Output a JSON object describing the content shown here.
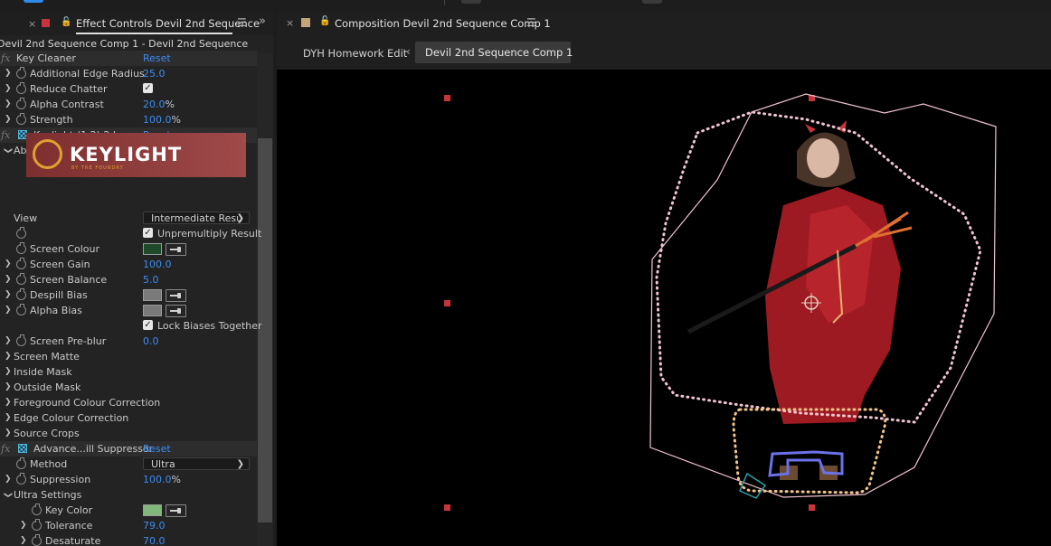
{
  "left_panel": {
    "tab": {
      "close": "×",
      "title": "Effect Controls Devil 2nd Sequence",
      "menu": "☰",
      "expand": "»"
    },
    "breadcrumb": "Devil 2nd Sequence Comp 1 - Devil 2nd Sequence",
    "rows": {
      "key_cleaner": {
        "fx": "fx",
        "label": "Key Cleaner",
        "reset": "Reset"
      },
      "edge_radius": {
        "label": "Additional Edge Radius",
        "value": "25.0"
      },
      "reduce_chatter": {
        "label": "Reduce Chatter",
        "checked": true
      },
      "alpha_contrast": {
        "label": "Alpha Contrast",
        "value": "20.0",
        "unit": "%"
      },
      "strength": {
        "label": "Strength",
        "value": "100.0",
        "unit": "%"
      },
      "keylight": {
        "fx": "fx",
        "label": "Keylight (1.2) 2 Lower",
        "reset": "Reset"
      },
      "about": {
        "label": "About"
      },
      "logo": {
        "text": "KEYLIGHT",
        "subtext": "BY THE FOUNDRY"
      },
      "view": {
        "label": "View",
        "value": "Intermediate Resu"
      },
      "unpremultiply": {
        "label": "Unpremultiply Result",
        "checked": true
      },
      "screen_colour": {
        "label": "Screen Colour",
        "color": "#1f4a2a"
      },
      "screen_gain": {
        "label": "Screen Gain",
        "value": "100.0"
      },
      "screen_balance": {
        "label": "Screen Balance",
        "value": "5.0"
      },
      "despill_bias": {
        "label": "Despill Bias",
        "color": "#7a7a7a"
      },
      "alpha_bias": {
        "label": "Alpha Bias",
        "color": "#7a7a7a"
      },
      "lock_biases": {
        "label": "Lock Biases Together",
        "checked": true
      },
      "screen_preblur": {
        "label": "Screen Pre-blur",
        "value": "0.0"
      },
      "screen_matte": {
        "label": "Screen Matte"
      },
      "inside_mask": {
        "label": "Inside Mask"
      },
      "outside_mask": {
        "label": "Outside Mask"
      },
      "fg_correction": {
        "label": "Foreground Colour Correction"
      },
      "edge_correction": {
        "label": "Edge Colour Correction"
      },
      "source_crops": {
        "label": "Source Crops"
      },
      "spill": {
        "fx": "fx",
        "label": "Advance...ill Suppressor",
        "reset": "Reset"
      },
      "method": {
        "label": "Method",
        "value": "Ultra"
      },
      "suppression": {
        "label": "Suppression",
        "value": "100.0",
        "unit": "%"
      },
      "ultra_settings": {
        "label": "Ultra Settings"
      },
      "key_color": {
        "label": "Key Color",
        "color": "#7fb87a"
      },
      "tolerance": {
        "label": "Tolerance",
        "value": "79.0"
      },
      "desaturate": {
        "label": "Desaturate",
        "value": "70.0"
      }
    }
  },
  "right_panel": {
    "tab": {
      "close": "×",
      "title": "Composition Devil 2nd Sequence Comp 1",
      "menu": "☰"
    },
    "breadcrumbs": {
      "first": "DYH Homework Edit",
      "arrow": "‹",
      "current": "Devil 2nd Sequence Comp 1"
    }
  },
  "colors": {
    "accent_blue": "#3d8cf0",
    "mask_pink": "#f0c4d0",
    "mask_orange": "#f2c48c",
    "mask_blue": "#6b72e8",
    "mask_teal": "#2aa3a6",
    "handle_red": "#c8343b"
  }
}
